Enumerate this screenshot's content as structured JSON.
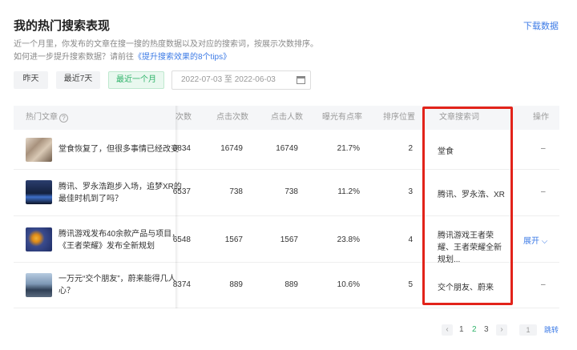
{
  "header": {
    "title": "我的热门搜索表现",
    "download": "下载数据",
    "desc1": "近一个月里，你发布的文章在搜一搜的热度数据以及对应的搜索词，按展示次数排序。",
    "desc2_prefix": "如何进一步提升搜索数据？请前往",
    "desc2_link": "《提升搜索效果的8个tips》"
  },
  "filters": {
    "yesterday": "昨天",
    "last7": "最近7天",
    "last30": "最近一个月",
    "date_range": "2022-07-03 至 2022-06-03"
  },
  "columns": {
    "article": "热门文章",
    "impressions": "次数",
    "clicks": "点击次数",
    "clickers": "点击人数",
    "ctr": "曝光有点率",
    "rank": "排序位置",
    "keywords": "文章搜索词",
    "actions": "操作",
    "help": "?"
  },
  "rows": [
    {
      "title": "堂食恢复了，但很多事情已经改变",
      "impressions": "6834",
      "clicks": "16749",
      "clickers": "16749",
      "ctr": "21.7%",
      "rank": "2",
      "keywords": "堂食",
      "action": "–"
    },
    {
      "title": "腾讯、罗永浩跑步入场，追梦XR的最佳时机到了吗？",
      "impressions": "6537",
      "clicks": "738",
      "clickers": "738",
      "ctr": "11.2%",
      "rank": "3",
      "keywords": "腾讯、罗永浩、XR",
      "action": "–"
    },
    {
      "title": "腾讯游戏发布40余款产品与项目，《王者荣耀》发布全新规划",
      "impressions": "6548",
      "clicks": "1567",
      "clickers": "1567",
      "ctr": "23.8%",
      "rank": "4",
      "keywords": "腾讯游戏王者荣耀、王者荣耀全新规划...",
      "action": "展开 ⌵"
    },
    {
      "title": "一万元“交个朋友”，蔚来能得几人心？",
      "impressions": "8374",
      "clicks": "889",
      "clickers": "889",
      "ctr": "10.6%",
      "rank": "5",
      "keywords": "交个朋友、蔚来",
      "action": "–"
    }
  ],
  "pagination": {
    "prev": "‹",
    "next": "›",
    "pages": [
      "1",
      "2",
      "3"
    ],
    "current": "2",
    "input": "1",
    "jump": "跳转"
  },
  "colors": {
    "accent_green": "#2fb36a",
    "link_blue": "#3d7be6",
    "highlight_red": "#e2231a"
  }
}
